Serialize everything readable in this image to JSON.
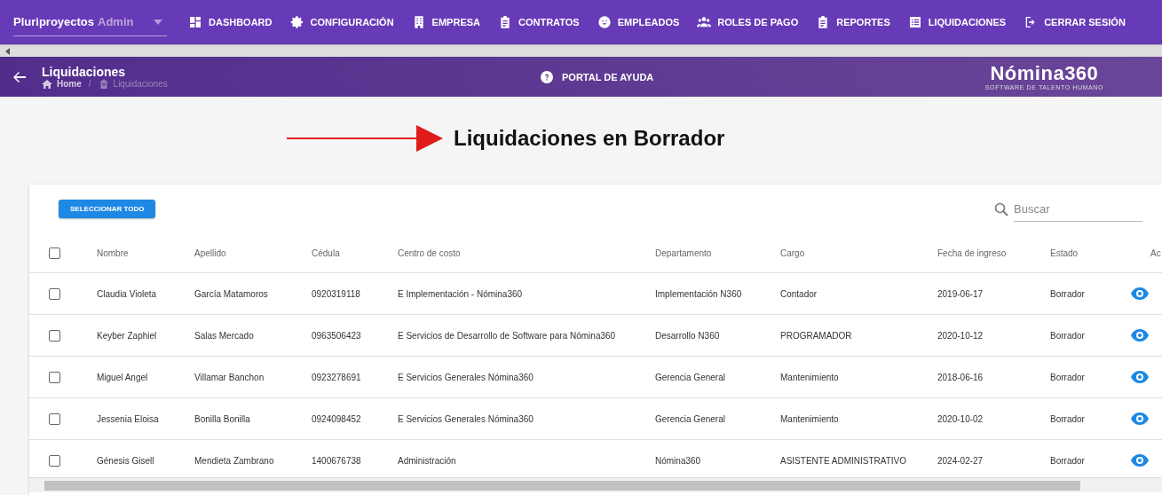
{
  "nav": {
    "company": "Pluriproyectos",
    "role": "Admin",
    "items": [
      {
        "kind": "dashboard",
        "label": "DASHBOARD"
      },
      {
        "kind": "gear",
        "label": "CONFIGURACIÓN"
      },
      {
        "kind": "building",
        "label": "EMPRESA"
      },
      {
        "kind": "clipboard",
        "label": "CONTRATOS"
      },
      {
        "kind": "face",
        "label": "EMPLEADOS"
      },
      {
        "kind": "users",
        "label": "ROLES DE PAGO"
      },
      {
        "kind": "clipboard",
        "label": "REPORTES"
      },
      {
        "kind": "list",
        "label": "LIQUIDACIONES"
      },
      {
        "kind": "logout",
        "label": "CERRAR SESIÓN"
      }
    ]
  },
  "header": {
    "title": "Liquidaciones",
    "breadcrumb": [
      "Home",
      "Liquidaciones"
    ],
    "breadcrumb_separator": "/",
    "help": "PORTAL DE AYUDA",
    "logo": "Nómina360",
    "logo_tagline": "SOFTWARE DE TALENTO HUMANO"
  },
  "page_title": "Liquidaciones en Borrador",
  "table": {
    "select_all": "SELECCIONAR TODO",
    "search": {
      "placeholder": "Buscar"
    },
    "header_checked": false,
    "columns": [
      "Nombre",
      "Apellido",
      "Cédula",
      "Centro de costo",
      "Departamento",
      "Cargo",
      "Fecha de ingreso",
      "Estado",
      "Ac"
    ],
    "rows": [
      {
        "checked": false,
        "cells": [
          "Claudia Violeta",
          "García Matamoros",
          "0920319118",
          "E Implementación - Nómina360",
          "Implementación N360",
          "Contador",
          "2019-06-17",
          "Borrador"
        ]
      },
      {
        "checked": false,
        "cells": [
          "Keyber Zaphiel",
          "Salas Mercado",
          "0963506423",
          "E Servicios de Desarrollo de Software para Nómina360",
          "Desarrollo N360",
          "PROGRAMADOR",
          "2020-10-12",
          "Borrador"
        ]
      },
      {
        "checked": false,
        "cells": [
          "Miguel Angel",
          "Villamar Banchon",
          "0923278691",
          "E Servicios Generales Nómina360",
          "Gerencia General",
          "Mantenimiento",
          "2018-06-16",
          "Borrador"
        ]
      },
      {
        "checked": false,
        "cells": [
          "Jessenia Eloisa",
          "Bonilla Bonilla",
          "0924098452",
          "E Servicios Generales Nómina360",
          "Gerencia General",
          "Mantenimiento",
          "2020-10-02",
          "Borrador"
        ]
      },
      {
        "checked": false,
        "cells": [
          "Génesis Gisell",
          "Mendieta Zambrano",
          "1400676738",
          "Administración",
          "Nómina360",
          "ASISTENTE ADMINISTRATIVO",
          "2024-02-27",
          "Borrador"
        ]
      }
    ]
  }
}
